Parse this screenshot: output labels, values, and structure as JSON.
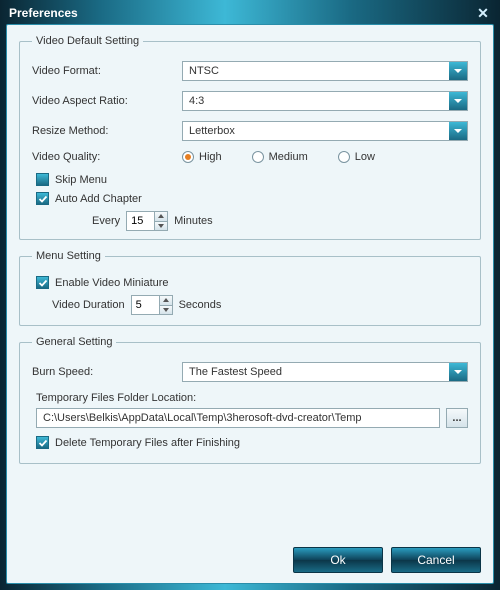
{
  "window": {
    "title": "Preferences"
  },
  "video": {
    "legend": "Video Default Setting",
    "format_label": "Video Format:",
    "format_value": "NTSC",
    "aspect_label": "Video Aspect Ratio:",
    "aspect_value": "4:3",
    "resize_label": "Resize Method:",
    "resize_value": "Letterbox",
    "quality_label": "Video Quality:",
    "quality_high": "High",
    "quality_medium": "Medium",
    "quality_low": "Low",
    "skip_menu": "Skip Menu",
    "auto_add_chapter": "Auto Add Chapter",
    "every": "Every",
    "chapter_minutes": "15",
    "minutes": "Minutes"
  },
  "menu": {
    "legend": "Menu Setting",
    "enable_miniature": "Enable Video Miniature",
    "video_duration_label": "Video Duration",
    "duration_value": "5",
    "seconds": "Seconds"
  },
  "general": {
    "legend": "General Setting",
    "burn_speed_label": "Burn Speed:",
    "burn_speed_value": "The Fastest Speed",
    "temp_label": "Temporary Files Folder Location:",
    "temp_path": "C:\\Users\\Belkis\\AppData\\Local\\Temp\\3herosoft-dvd-creator\\Temp",
    "browse": "...",
    "delete_temp": "Delete Temporary Files after Finishing"
  },
  "buttons": {
    "ok": "Ok",
    "cancel": "Cancel"
  }
}
